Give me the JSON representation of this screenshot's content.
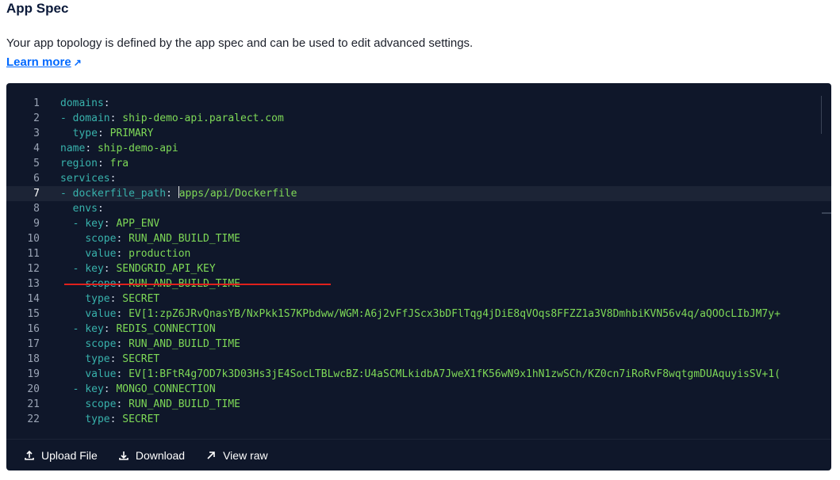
{
  "header": {
    "title": "App Spec",
    "description": "Your app topology is defined by the app spec and can be used to edit advanced settings.",
    "learn_more": "Learn more",
    "learn_more_icon": "external-link-icon"
  },
  "editor": {
    "current_line": 7,
    "lines": [
      {
        "n": "1",
        "indent": "",
        "dash": "",
        "key": "domains",
        "value": ""
      },
      {
        "n": "2",
        "indent": "",
        "dash": "- ",
        "key": "domain",
        "value": "ship-demo-api.paralect.com"
      },
      {
        "n": "3",
        "indent": "  ",
        "dash": "",
        "key": "type",
        "value": "PRIMARY"
      },
      {
        "n": "4",
        "indent": "",
        "dash": "",
        "key": "name",
        "value": "ship-demo-api"
      },
      {
        "n": "5",
        "indent": "",
        "dash": "",
        "key": "region",
        "value": "fra"
      },
      {
        "n": "6",
        "indent": "",
        "dash": "",
        "key": "services",
        "value": ""
      },
      {
        "n": "7",
        "indent": "",
        "dash": "- ",
        "key": "dockerfile_path",
        "value": "apps/api/Dockerfile"
      },
      {
        "n": "8",
        "indent": "  ",
        "dash": "",
        "key": "envs",
        "value": ""
      },
      {
        "n": "9",
        "indent": "  ",
        "dash": "- ",
        "key": "key",
        "value": "APP_ENV"
      },
      {
        "n": "10",
        "indent": "    ",
        "dash": "",
        "key": "scope",
        "value": "RUN_AND_BUILD_TIME"
      },
      {
        "n": "11",
        "indent": "    ",
        "dash": "",
        "key": "value",
        "value": "production"
      },
      {
        "n": "12",
        "indent": "  ",
        "dash": "- ",
        "key": "key",
        "value": "SENDGRID_API_KEY"
      },
      {
        "n": "13",
        "indent": "    ",
        "dash": "",
        "key": "scope",
        "value": "RUN_AND_BUILD_TIME"
      },
      {
        "n": "14",
        "indent": "    ",
        "dash": "",
        "key": "type",
        "value": "SECRET"
      },
      {
        "n": "15",
        "indent": "    ",
        "dash": "",
        "key": "value",
        "value": "EV[1:zpZ6JRvQnasYB/NxPkk1S7KPbdww/WGM:A6j2vFfJScx3bDFlTqg4jDiE8qVOqs8FFZZ1a3V8DmhbiKVN56v4q/aQOOcLIbJM7y+"
      },
      {
        "n": "16",
        "indent": "  ",
        "dash": "- ",
        "key": "key",
        "value": "REDIS_CONNECTION"
      },
      {
        "n": "17",
        "indent": "    ",
        "dash": "",
        "key": "scope",
        "value": "RUN_AND_BUILD_TIME"
      },
      {
        "n": "18",
        "indent": "    ",
        "dash": "",
        "key": "type",
        "value": "SECRET"
      },
      {
        "n": "19",
        "indent": "    ",
        "dash": "",
        "key": "value",
        "value": "EV[1:BFtR4g7OD7k3D03Hs3jE4SocLTBLwcBZ:U4aSCMLkidbA7JweX1fK56wN9x1hN1zwSCh/KZ0cn7iRoRvF8wqtgmDUAquyisSV+1("
      },
      {
        "n": "20",
        "indent": "  ",
        "dash": "- ",
        "key": "key",
        "value": "MONGO_CONNECTION"
      },
      {
        "n": "21",
        "indent": "    ",
        "dash": "",
        "key": "scope",
        "value": "RUN_AND_BUILD_TIME"
      },
      {
        "n": "22",
        "indent": "    ",
        "dash": "",
        "key": "type",
        "value": "SECRET"
      }
    ]
  },
  "footer": {
    "upload_label": "Upload File",
    "upload_icon": "upload-icon",
    "download_label": "Download",
    "download_icon": "download-icon",
    "view_raw_label": "View raw",
    "view_raw_icon": "arrow-up-right-icon"
  }
}
